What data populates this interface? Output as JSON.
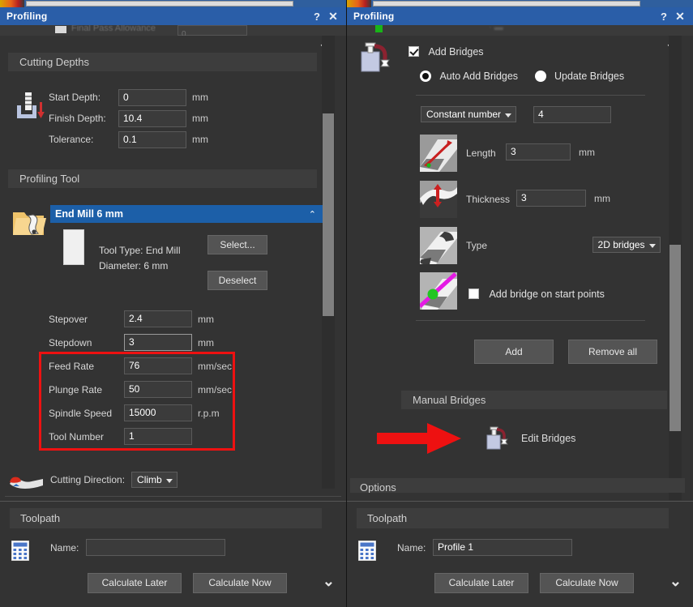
{
  "window": {
    "title": "Profiling",
    "help_label": "?",
    "close_label": "✕"
  },
  "left_panel": {
    "ghost_row": {
      "label": "Final Pass Allowance",
      "value": "0"
    },
    "cutting_depths": {
      "header": "Cutting Depths",
      "icon": "cutting-depth-icon",
      "fields": [
        {
          "label": "Start Depth:",
          "value": "0",
          "unit": "mm"
        },
        {
          "label": "Finish Depth:",
          "value": "10.4",
          "unit": "mm"
        },
        {
          "label": "Tolerance:",
          "value": "0.1",
          "unit": "mm"
        }
      ]
    },
    "profiling_tool": {
      "header": "Profiling Tool",
      "icon": "tool-folder-icon",
      "selected_tool": "End Mill 6 mm",
      "collapse_chevron": "⌃",
      "tool_type_line": "Tool Type: End Mill",
      "diameter_line": "Diameter:  6 mm",
      "select_button": "Select...",
      "deselect_button": "Deselect",
      "params": [
        {
          "label": "Stepover",
          "value": "2.4",
          "unit": "mm",
          "highlight": false
        },
        {
          "label": "Stepdown",
          "value": "3",
          "unit": "mm",
          "highlight": false
        },
        {
          "label": "Feed Rate",
          "value": "76",
          "unit": "mm/sec",
          "highlight": true
        },
        {
          "label": "Plunge Rate",
          "value": "50",
          "unit": "mm/sec",
          "highlight": true
        },
        {
          "label": "Spindle Speed",
          "value": "15000",
          "unit": "r.p.m",
          "highlight": true
        },
        {
          "label": "Tool Number",
          "value": "1",
          "unit": "",
          "highlight": true
        }
      ],
      "highlight_color": "#ee1111"
    },
    "cutting_direction": {
      "icon": "cutting-direction-icon",
      "label": "Cutting Direction:",
      "value": "Climb"
    },
    "toolpath": {
      "header": "Toolpath",
      "icon": "calculator-icon",
      "name_label": "Name:",
      "name_value": "",
      "name_placeholder": "",
      "calculate_later": "Calculate Later",
      "calculate_now": "Calculate Now",
      "scroll_down_chevron": "⌄"
    }
  },
  "right_panel": {
    "bridges": {
      "icon": "bridge-icon",
      "add_bridges_label": "Add Bridges",
      "add_bridges_checked": true,
      "auto_add_label": "Auto Add Bridges",
      "auto_add_selected": true,
      "update_label": "Update Bridges",
      "update_selected": false,
      "mode_select": "Constant number",
      "count_value": "4",
      "length_label": "Length",
      "length_value": "3",
      "length_unit": "mm",
      "thickness_label": "Thickness",
      "thickness_value": "3",
      "thickness_unit": "mm",
      "type_label": "Type",
      "type_value": "2D bridges",
      "start_points_label": "Add bridge on start points",
      "start_points_checked": false,
      "add_button": "Add",
      "remove_all_button": "Remove all",
      "collapse_chevron": "⌃"
    },
    "manual_bridges": {
      "header": "Manual Bridges",
      "edit_icon": "edit-bridges-icon",
      "edit_label": "Edit Bridges",
      "pointer": "red-arrow-annotation"
    },
    "options": {
      "header": "Options"
    },
    "toolpath": {
      "header": "Toolpath",
      "icon": "calculator-icon",
      "name_label": "Name:",
      "name_value": "Profile 1",
      "calculate_later": "Calculate Later",
      "calculate_now": "Calculate Now",
      "scroll_down_chevron": "⌄"
    }
  }
}
